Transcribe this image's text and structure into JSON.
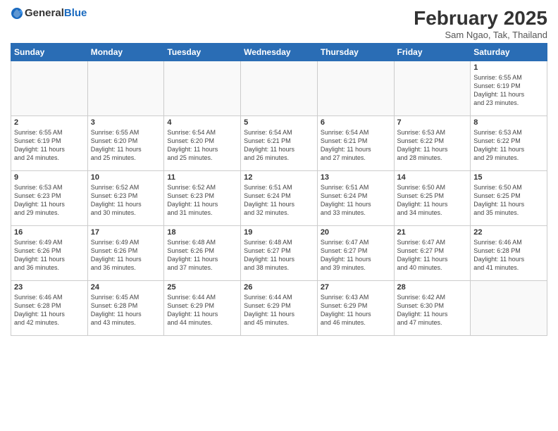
{
  "logo": {
    "general": "General",
    "blue": "Blue"
  },
  "title": "February 2025",
  "subtitle": "Sam Ngao, Tak, Thailand",
  "days_header": [
    "Sunday",
    "Monday",
    "Tuesday",
    "Wednesday",
    "Thursday",
    "Friday",
    "Saturday"
  ],
  "weeks": [
    [
      {
        "day": "",
        "info": ""
      },
      {
        "day": "",
        "info": ""
      },
      {
        "day": "",
        "info": ""
      },
      {
        "day": "",
        "info": ""
      },
      {
        "day": "",
        "info": ""
      },
      {
        "day": "",
        "info": ""
      },
      {
        "day": "1",
        "info": "Sunrise: 6:55 AM\nSunset: 6:19 PM\nDaylight: 11 hours\nand 23 minutes."
      }
    ],
    [
      {
        "day": "2",
        "info": "Sunrise: 6:55 AM\nSunset: 6:19 PM\nDaylight: 11 hours\nand 24 minutes."
      },
      {
        "day": "3",
        "info": "Sunrise: 6:55 AM\nSunset: 6:20 PM\nDaylight: 11 hours\nand 25 minutes."
      },
      {
        "day": "4",
        "info": "Sunrise: 6:54 AM\nSunset: 6:20 PM\nDaylight: 11 hours\nand 25 minutes."
      },
      {
        "day": "5",
        "info": "Sunrise: 6:54 AM\nSunset: 6:21 PM\nDaylight: 11 hours\nand 26 minutes."
      },
      {
        "day": "6",
        "info": "Sunrise: 6:54 AM\nSunset: 6:21 PM\nDaylight: 11 hours\nand 27 minutes."
      },
      {
        "day": "7",
        "info": "Sunrise: 6:53 AM\nSunset: 6:22 PM\nDaylight: 11 hours\nand 28 minutes."
      },
      {
        "day": "8",
        "info": "Sunrise: 6:53 AM\nSunset: 6:22 PM\nDaylight: 11 hours\nand 29 minutes."
      }
    ],
    [
      {
        "day": "9",
        "info": "Sunrise: 6:53 AM\nSunset: 6:23 PM\nDaylight: 11 hours\nand 29 minutes."
      },
      {
        "day": "10",
        "info": "Sunrise: 6:52 AM\nSunset: 6:23 PM\nDaylight: 11 hours\nand 30 minutes."
      },
      {
        "day": "11",
        "info": "Sunrise: 6:52 AM\nSunset: 6:23 PM\nDaylight: 11 hours\nand 31 minutes."
      },
      {
        "day": "12",
        "info": "Sunrise: 6:51 AM\nSunset: 6:24 PM\nDaylight: 11 hours\nand 32 minutes."
      },
      {
        "day": "13",
        "info": "Sunrise: 6:51 AM\nSunset: 6:24 PM\nDaylight: 11 hours\nand 33 minutes."
      },
      {
        "day": "14",
        "info": "Sunrise: 6:50 AM\nSunset: 6:25 PM\nDaylight: 11 hours\nand 34 minutes."
      },
      {
        "day": "15",
        "info": "Sunrise: 6:50 AM\nSunset: 6:25 PM\nDaylight: 11 hours\nand 35 minutes."
      }
    ],
    [
      {
        "day": "16",
        "info": "Sunrise: 6:49 AM\nSunset: 6:26 PM\nDaylight: 11 hours\nand 36 minutes."
      },
      {
        "day": "17",
        "info": "Sunrise: 6:49 AM\nSunset: 6:26 PM\nDaylight: 11 hours\nand 36 minutes."
      },
      {
        "day": "18",
        "info": "Sunrise: 6:48 AM\nSunset: 6:26 PM\nDaylight: 11 hours\nand 37 minutes."
      },
      {
        "day": "19",
        "info": "Sunrise: 6:48 AM\nSunset: 6:27 PM\nDaylight: 11 hours\nand 38 minutes."
      },
      {
        "day": "20",
        "info": "Sunrise: 6:47 AM\nSunset: 6:27 PM\nDaylight: 11 hours\nand 39 minutes."
      },
      {
        "day": "21",
        "info": "Sunrise: 6:47 AM\nSunset: 6:27 PM\nDaylight: 11 hours\nand 40 minutes."
      },
      {
        "day": "22",
        "info": "Sunrise: 6:46 AM\nSunset: 6:28 PM\nDaylight: 11 hours\nand 41 minutes."
      }
    ],
    [
      {
        "day": "23",
        "info": "Sunrise: 6:46 AM\nSunset: 6:28 PM\nDaylight: 11 hours\nand 42 minutes."
      },
      {
        "day": "24",
        "info": "Sunrise: 6:45 AM\nSunset: 6:28 PM\nDaylight: 11 hours\nand 43 minutes."
      },
      {
        "day": "25",
        "info": "Sunrise: 6:44 AM\nSunset: 6:29 PM\nDaylight: 11 hours\nand 44 minutes."
      },
      {
        "day": "26",
        "info": "Sunrise: 6:44 AM\nSunset: 6:29 PM\nDaylight: 11 hours\nand 45 minutes."
      },
      {
        "day": "27",
        "info": "Sunrise: 6:43 AM\nSunset: 6:29 PM\nDaylight: 11 hours\nand 46 minutes."
      },
      {
        "day": "28",
        "info": "Sunrise: 6:42 AM\nSunset: 6:30 PM\nDaylight: 11 hours\nand 47 minutes."
      },
      {
        "day": "",
        "info": ""
      }
    ]
  ]
}
